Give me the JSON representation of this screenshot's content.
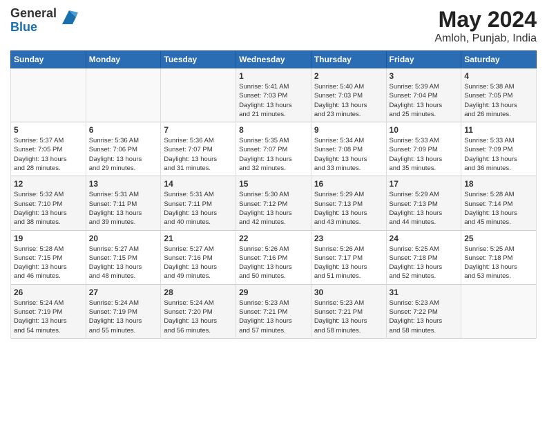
{
  "header": {
    "logo_general": "General",
    "logo_blue": "Blue",
    "main_title": "May 2024",
    "subtitle": "Amloh, Punjab, India"
  },
  "days_of_week": [
    "Sunday",
    "Monday",
    "Tuesday",
    "Wednesday",
    "Thursday",
    "Friday",
    "Saturday"
  ],
  "weeks": [
    [
      {
        "day": "",
        "info": ""
      },
      {
        "day": "",
        "info": ""
      },
      {
        "day": "",
        "info": ""
      },
      {
        "day": "1",
        "info": "Sunrise: 5:41 AM\nSunset: 7:03 PM\nDaylight: 13 hours\nand 21 minutes."
      },
      {
        "day": "2",
        "info": "Sunrise: 5:40 AM\nSunset: 7:03 PM\nDaylight: 13 hours\nand 23 minutes."
      },
      {
        "day": "3",
        "info": "Sunrise: 5:39 AM\nSunset: 7:04 PM\nDaylight: 13 hours\nand 25 minutes."
      },
      {
        "day": "4",
        "info": "Sunrise: 5:38 AM\nSunset: 7:05 PM\nDaylight: 13 hours\nand 26 minutes."
      }
    ],
    [
      {
        "day": "5",
        "info": "Sunrise: 5:37 AM\nSunset: 7:05 PM\nDaylight: 13 hours\nand 28 minutes."
      },
      {
        "day": "6",
        "info": "Sunrise: 5:36 AM\nSunset: 7:06 PM\nDaylight: 13 hours\nand 29 minutes."
      },
      {
        "day": "7",
        "info": "Sunrise: 5:36 AM\nSunset: 7:07 PM\nDaylight: 13 hours\nand 31 minutes."
      },
      {
        "day": "8",
        "info": "Sunrise: 5:35 AM\nSunset: 7:07 PM\nDaylight: 13 hours\nand 32 minutes."
      },
      {
        "day": "9",
        "info": "Sunrise: 5:34 AM\nSunset: 7:08 PM\nDaylight: 13 hours\nand 33 minutes."
      },
      {
        "day": "10",
        "info": "Sunrise: 5:33 AM\nSunset: 7:09 PM\nDaylight: 13 hours\nand 35 minutes."
      },
      {
        "day": "11",
        "info": "Sunrise: 5:33 AM\nSunset: 7:09 PM\nDaylight: 13 hours\nand 36 minutes."
      }
    ],
    [
      {
        "day": "12",
        "info": "Sunrise: 5:32 AM\nSunset: 7:10 PM\nDaylight: 13 hours\nand 38 minutes."
      },
      {
        "day": "13",
        "info": "Sunrise: 5:31 AM\nSunset: 7:11 PM\nDaylight: 13 hours\nand 39 minutes."
      },
      {
        "day": "14",
        "info": "Sunrise: 5:31 AM\nSunset: 7:11 PM\nDaylight: 13 hours\nand 40 minutes."
      },
      {
        "day": "15",
        "info": "Sunrise: 5:30 AM\nSunset: 7:12 PM\nDaylight: 13 hours\nand 42 minutes."
      },
      {
        "day": "16",
        "info": "Sunrise: 5:29 AM\nSunset: 7:13 PM\nDaylight: 13 hours\nand 43 minutes."
      },
      {
        "day": "17",
        "info": "Sunrise: 5:29 AM\nSunset: 7:13 PM\nDaylight: 13 hours\nand 44 minutes."
      },
      {
        "day": "18",
        "info": "Sunrise: 5:28 AM\nSunset: 7:14 PM\nDaylight: 13 hours\nand 45 minutes."
      }
    ],
    [
      {
        "day": "19",
        "info": "Sunrise: 5:28 AM\nSunset: 7:15 PM\nDaylight: 13 hours\nand 46 minutes."
      },
      {
        "day": "20",
        "info": "Sunrise: 5:27 AM\nSunset: 7:15 PM\nDaylight: 13 hours\nand 48 minutes."
      },
      {
        "day": "21",
        "info": "Sunrise: 5:27 AM\nSunset: 7:16 PM\nDaylight: 13 hours\nand 49 minutes."
      },
      {
        "day": "22",
        "info": "Sunrise: 5:26 AM\nSunset: 7:16 PM\nDaylight: 13 hours\nand 50 minutes."
      },
      {
        "day": "23",
        "info": "Sunrise: 5:26 AM\nSunset: 7:17 PM\nDaylight: 13 hours\nand 51 minutes."
      },
      {
        "day": "24",
        "info": "Sunrise: 5:25 AM\nSunset: 7:18 PM\nDaylight: 13 hours\nand 52 minutes."
      },
      {
        "day": "25",
        "info": "Sunrise: 5:25 AM\nSunset: 7:18 PM\nDaylight: 13 hours\nand 53 minutes."
      }
    ],
    [
      {
        "day": "26",
        "info": "Sunrise: 5:24 AM\nSunset: 7:19 PM\nDaylight: 13 hours\nand 54 minutes."
      },
      {
        "day": "27",
        "info": "Sunrise: 5:24 AM\nSunset: 7:19 PM\nDaylight: 13 hours\nand 55 minutes."
      },
      {
        "day": "28",
        "info": "Sunrise: 5:24 AM\nSunset: 7:20 PM\nDaylight: 13 hours\nand 56 minutes."
      },
      {
        "day": "29",
        "info": "Sunrise: 5:23 AM\nSunset: 7:21 PM\nDaylight: 13 hours\nand 57 minutes."
      },
      {
        "day": "30",
        "info": "Sunrise: 5:23 AM\nSunset: 7:21 PM\nDaylight: 13 hours\nand 58 minutes."
      },
      {
        "day": "31",
        "info": "Sunrise: 5:23 AM\nSunset: 7:22 PM\nDaylight: 13 hours\nand 58 minutes."
      },
      {
        "day": "",
        "info": ""
      }
    ]
  ]
}
